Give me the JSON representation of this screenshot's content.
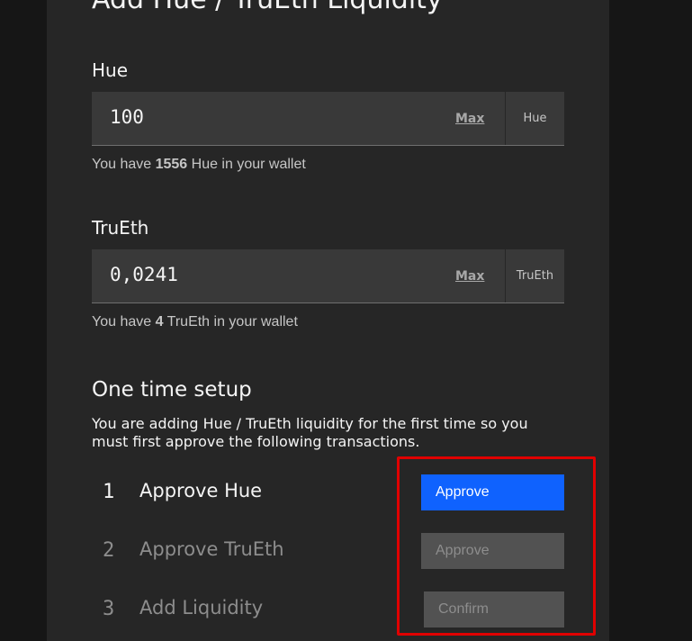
{
  "page": {
    "title": "Add Hue / TruEth Liquidity"
  },
  "hue": {
    "label": "Hue",
    "value": "100",
    "max_label": "Max",
    "unit": "Hue",
    "hint_prefix": "You have ",
    "hint_amount": "1556",
    "hint_suffix": " Hue in your wallet"
  },
  "trueth": {
    "label": "TruEth",
    "value": "0,0241",
    "max_label": "Max",
    "unit": "TruEth",
    "hint_prefix": "You have ",
    "hint_amount": "4",
    "hint_suffix": " TruEth in your wallet"
  },
  "setup": {
    "title": "One time setup",
    "description": "You are adding Hue / TruEth liquidity for the first time so you must first approve the following transactions.",
    "steps": [
      {
        "number": "1",
        "label": "Approve Hue",
        "button": "Approve",
        "state": "active"
      },
      {
        "number": "2",
        "label": "Approve TruEth",
        "button": "Approve",
        "state": "disabled"
      },
      {
        "number": "3",
        "label": "Add Liquidity",
        "button": "Confirm",
        "state": "disabled"
      }
    ]
  },
  "colors": {
    "primary": "#0f62fe",
    "highlight": "#e00000",
    "panel": "#262626",
    "field": "#393939"
  }
}
